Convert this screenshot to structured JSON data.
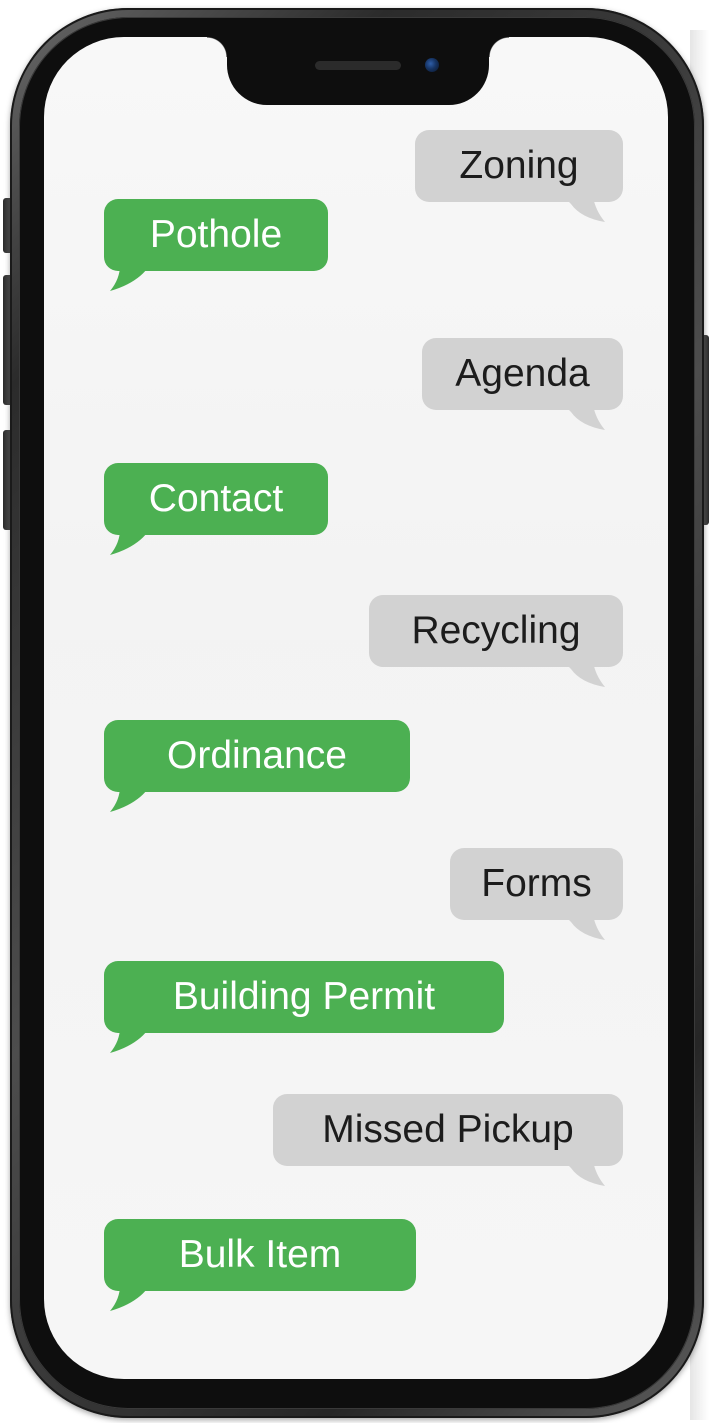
{
  "screen": {
    "background": "#f5f5f5"
  },
  "colors": {
    "green_bubble": "#4cb052",
    "gray_bubble": "#d2d2d2",
    "frame": "#2b2b2b"
  },
  "messages": [
    {
      "text": "Zoning",
      "side": "right",
      "color": "gray"
    },
    {
      "text": "Pothole",
      "side": "left",
      "color": "green"
    },
    {
      "text": "Agenda",
      "side": "right",
      "color": "gray"
    },
    {
      "text": "Contact",
      "side": "left",
      "color": "green"
    },
    {
      "text": "Recycling",
      "side": "right",
      "color": "gray"
    },
    {
      "text": "Ordinance",
      "side": "left",
      "color": "green"
    },
    {
      "text": "Forms",
      "side": "right",
      "color": "gray"
    },
    {
      "text": "Building Permit",
      "side": "left",
      "color": "green"
    },
    {
      "text": "Missed Pickup",
      "side": "right",
      "color": "gray"
    },
    {
      "text": "Bulk Item",
      "side": "left",
      "color": "green"
    }
  ]
}
